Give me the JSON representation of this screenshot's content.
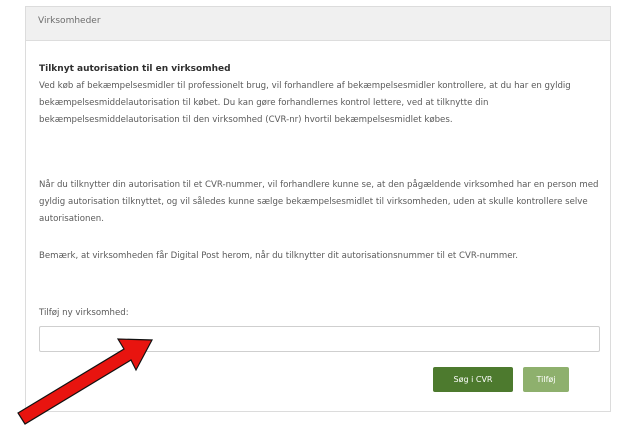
{
  "panel": {
    "header": "Virksomheder",
    "title": "Tilknyt autorisation til en virksomhed",
    "paragraphs": [
      "Ved køb af bekæmpelsesmidler til professionelt brug, vil forhandlere af bekæmpelsesmidler kontrollere, at du har en gyldig bekæmpelsesmiddelautorisation til købet. Du kan gøre forhandlernes kontrol lettere, ved at tilknytte din bekæmpelsesmiddelautorisation til den virksomhed (CVR-nr) hvortil bekæmpelsesmidlet købes.",
      "Når du tilknytter din autorisation til et CVR-nummer, vil forhandlere kunne se, at den pågældende virksomhed har en person med gyldig autorisation tilknyttet, og vil således kunne sælge bekæmpelsesmidlet til virksomheden, uden at skulle kontrollere selve autorisationen.",
      "Bemærk, at virksomheden får Digital Post herom, når du tilknytter dit autorisationsnummer til et CVR-nummer."
    ],
    "field_label": "Tilføj ny virksomhed:",
    "field_value": "",
    "search_button": "Søg i CVR",
    "add_button": "Tilføj"
  },
  "colors": {
    "search_button": "#4d7a2e",
    "add_button": "#8eb06d",
    "arrow": "#e8140f",
    "header_bg": "#f0f0f0"
  },
  "icons": {
    "annotation": "red-arrow-icon"
  }
}
